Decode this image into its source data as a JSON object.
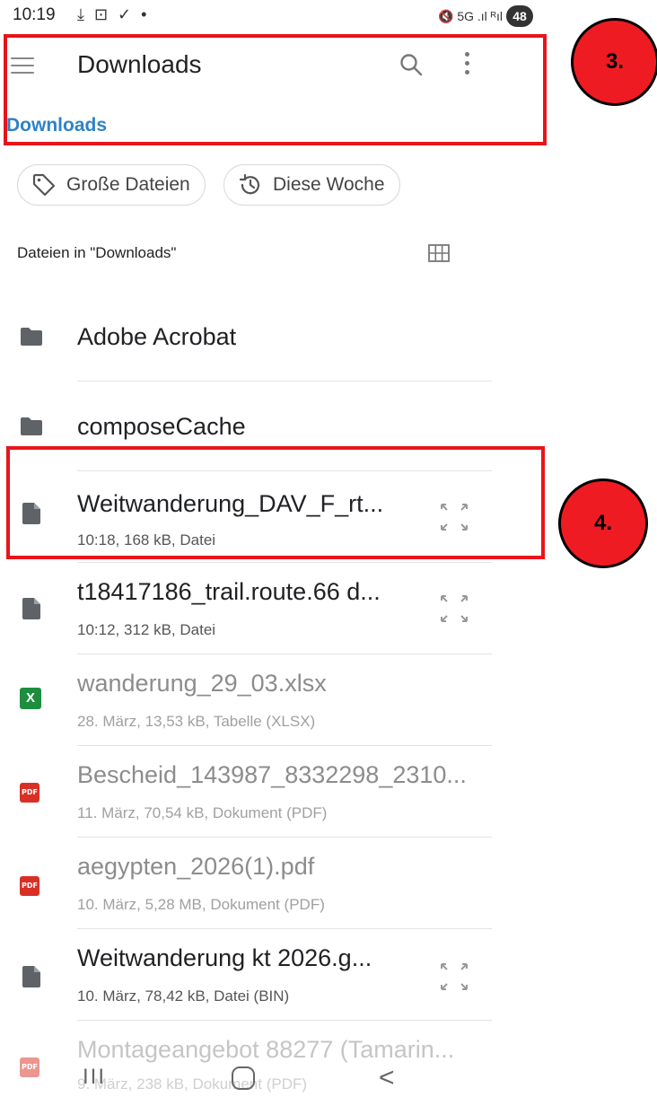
{
  "status_bar": {
    "time": "10:19",
    "left_icons": "⤓ ⊡ ✓ •",
    "right_icons": "🔇 5G .ıl ᴿıl",
    "battery": "48"
  },
  "app_bar": {
    "title": "Downloads"
  },
  "breadcrumb": "Downloads",
  "annotations": {
    "box_3_label": "3.",
    "box_4_label": "4."
  },
  "chips": [
    {
      "label": "Große Dateien",
      "icon": "tag-icon"
    },
    {
      "label": "Diese Woche",
      "icon": "history-icon"
    }
  ],
  "section_label": "Dateien in \"Downloads\"",
  "files": [
    {
      "title": "Adobe Acrobat",
      "subtitle": "",
      "icon": "folder-icon"
    },
    {
      "title": "composeCache",
      "subtitle": "",
      "icon": "folder-icon"
    },
    {
      "title": "Weitwanderung_DAV_F_rt...",
      "subtitle": "10:18, 168 kB, Datei",
      "icon": "file-icon"
    },
    {
      "title": "t18417186_trail.route.66 d...",
      "subtitle": "10:12, 312 kB, Datei",
      "icon": "file-icon"
    },
    {
      "title": "wanderung_29_03.xlsx",
      "subtitle": "28. März, 13,53 kB, Tabelle (XLSX)",
      "icon": "xlsx-icon",
      "badge": "X"
    },
    {
      "title": "Bescheid_143987_8332298_2310...",
      "subtitle": "11. März, 70,54 kB, Dokument (PDF)",
      "icon": "pdf-icon",
      "badge": "PDF"
    },
    {
      "title": "aegypten_2026(1).pdf",
      "subtitle": "10. März, 5,28 MB, Dokument (PDF)",
      "icon": "pdf-icon",
      "badge": "PDF"
    },
    {
      "title": "Weitwanderung kt 2026.g...",
      "subtitle": "10. März, 78,42 kB, Datei (BIN)",
      "icon": "file-icon"
    },
    {
      "title": "Montageangebot 88277 (Tamarin...",
      "subtitle": "9. März, 238 kB, Dokument (PDF)",
      "icon": "pdf-icon",
      "badge": "PDF"
    }
  ],
  "nav_bar": {
    "recent": "III",
    "back": "<"
  },
  "colors": {
    "accent": "#2e82c6",
    "annotation_red": "#e8141b",
    "pdf_red": "#d93025",
    "xlsx_green": "#1e8e3e"
  }
}
